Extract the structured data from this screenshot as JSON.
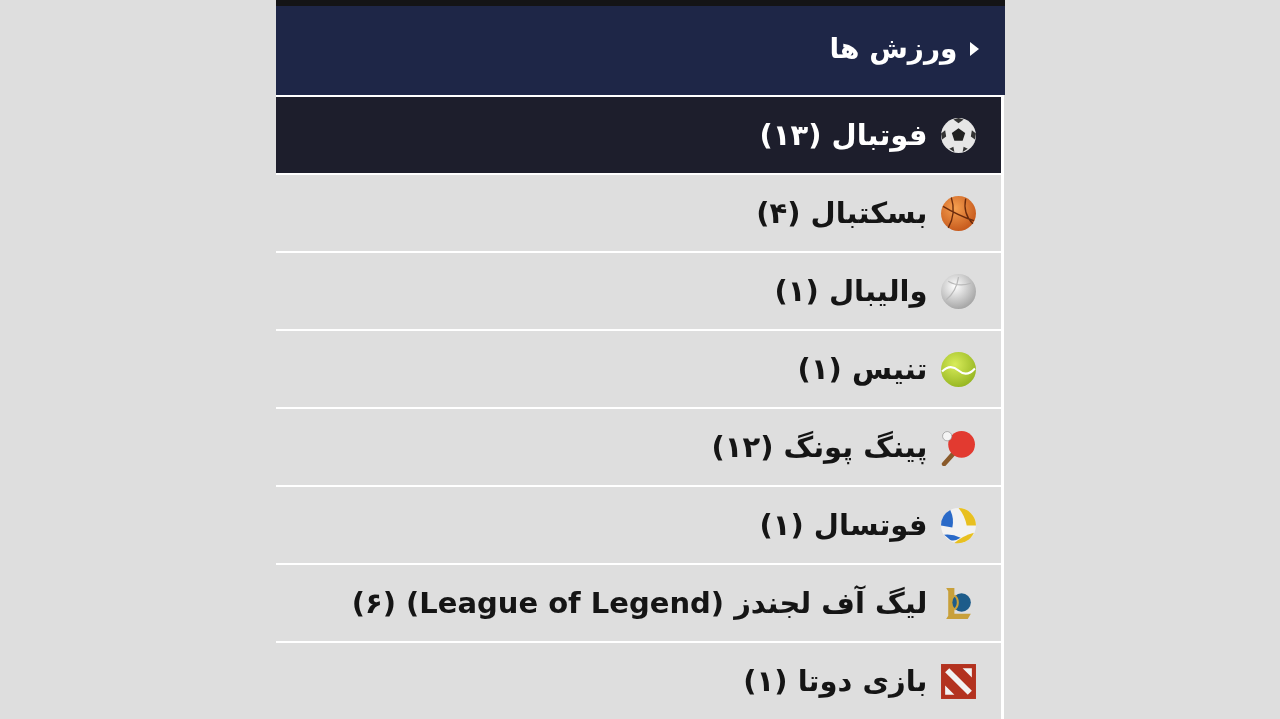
{
  "header": {
    "title": "ورزش ها"
  },
  "items": [
    {
      "kind": "soccer",
      "label": "فوتبال (۱۳)",
      "selected": true
    },
    {
      "kind": "basketball",
      "label": "بسکتبال (۴)",
      "selected": false
    },
    {
      "kind": "volleyball",
      "label": "والیبال (۱)",
      "selected": false
    },
    {
      "kind": "tennis",
      "label": "تنیس (۱)",
      "selected": false
    },
    {
      "kind": "pingpong",
      "label": "پینگ پونگ (۱۲)",
      "selected": false
    },
    {
      "kind": "futsal",
      "label": "فوتسال (۱)",
      "selected": false
    },
    {
      "kind": "lol",
      "label": "لیگ آف لجندز (League of Legend) (۶)",
      "selected": false
    },
    {
      "kind": "dota",
      "label": "بازی دوتا (۱)",
      "selected": false
    }
  ]
}
